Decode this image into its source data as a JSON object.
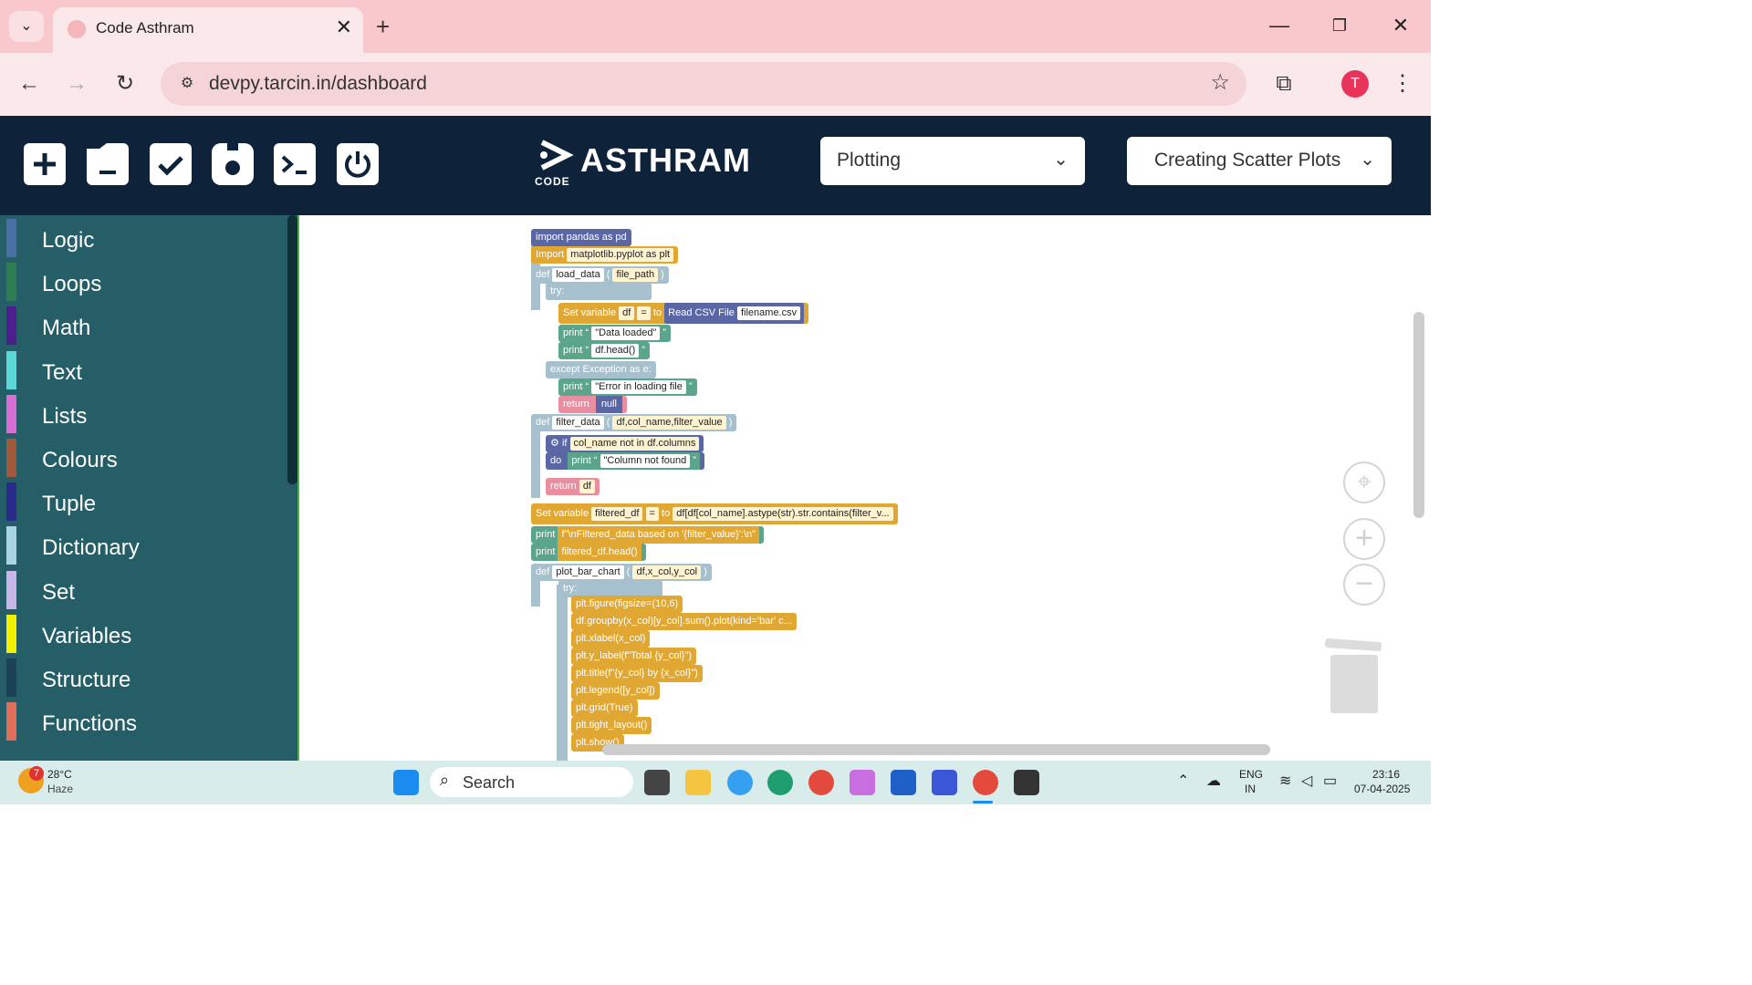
{
  "browser": {
    "tab_title": "Code Asthram",
    "url": "devpy.tarcin.in/dashboard",
    "profile_initial": "T"
  },
  "app": {
    "logo_word": "ASTHRAM",
    "logo_sub": "CODE",
    "topic_select": "Plotting",
    "lesson_select": "Creating Scatter Plots"
  },
  "sidebar": {
    "categories": [
      {
        "label": "Logic",
        "color": "#4a6fa5"
      },
      {
        "label": "Loops",
        "color": "#2e7d4f"
      },
      {
        "label": "Math",
        "color": "#4b1f8c"
      },
      {
        "label": "Text",
        "color": "#5ad7d7"
      },
      {
        "label": "Lists",
        "color": "#d66ed6"
      },
      {
        "label": "Colours",
        "color": "#a0593a"
      },
      {
        "label": "Tuple",
        "color": "#2a2a8a"
      },
      {
        "label": "Dictionary",
        "color": "#a8d4e6"
      },
      {
        "label": "Set",
        "color": "#c9b6e8"
      },
      {
        "label": "Variables",
        "color": "#f2f200"
      },
      {
        "label": "Structure",
        "color": "#1c4057"
      },
      {
        "label": "Functions",
        "color": "#e06c5a"
      }
    ]
  },
  "blocks": {
    "import_pandas": "import pandas as pd",
    "import_kw": "Import",
    "import_plt": "matplotlib.pyplot as plt",
    "def_kw": "def",
    "load_data": "load_data",
    "paren_open": "(",
    "paren_close": ")",
    "file_path": "file_path",
    "try_kw": "try:",
    "set_variable": "Set variable",
    "df": "df",
    "eq": "=",
    "to": "to",
    "read_csv": "Read CSV File",
    "filename": "filename.csv",
    "print_kw": "print",
    "quote_open": "“",
    "quote_close": "”",
    "data_loaded": "\"Data loaded\"",
    "df_head": "df.head()",
    "except_line": "except Exception as e:",
    "error_loading": "\"Error in loading file",
    "return_kw": "return",
    "null": "null",
    "filter_data": "filter_data",
    "filter_args": "df,col_name,filter_value",
    "if_kw": "if",
    "col_cond": "col_name not in df.columns",
    "do_kw": "do",
    "col_not_found": "\"Column not found",
    "filtered_df": "filtered_df",
    "filter_expr": "df[df[col_name].astype(str).str.contains(filter_v...",
    "print_filtered": "f\"\\nFiltered_data based on '{filter_value}':\\n\"",
    "print_filtered_head": "filtered_df.head()",
    "plot_bar_chart": "plot_bar_chart",
    "plot_args": "df,x_col,y_col",
    "plt_figure": "plt.figure(figsize=(10,6)",
    "plt_groupby": "df.groupby(x_col)[y_col].sum().plot(kind='bar' c...",
    "plt_xlabel": "plt.xlabel(x_col)",
    "plt_ylabel": "plt.y_label(f\"Total {y_col}\")",
    "plt_title": "plt.title(f\"{y_col} by {x_col}\")",
    "plt_legend": "plt.legend([y_col])",
    "plt_grid": "plt.grid(True)",
    "plt_tight": "plt.tight_layout()",
    "plt_show": "plt.show()"
  },
  "taskbar": {
    "weather_temp": "28°C",
    "weather_desc": "Haze",
    "weather_badge": "7",
    "search_label": "Search",
    "lang_top": "ENG",
    "lang_bottom": "IN",
    "time": "23:16",
    "date": "07-04-2025"
  }
}
